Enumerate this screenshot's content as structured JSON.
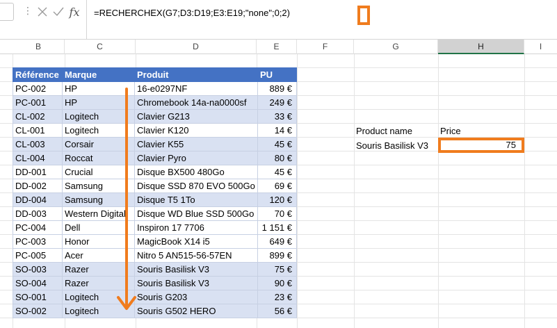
{
  "formula_bar": {
    "dots": "⋮",
    "cancel_icon": "close-icon",
    "enter_icon": "check-icon",
    "fx_label": "fx",
    "formula": "=RECHERCHEX(G7;D3:D19;E3:E19;\"none\";0;2)"
  },
  "columns": [
    "B",
    "C",
    "D",
    "E",
    "F",
    "G",
    "H",
    "I"
  ],
  "selected_column": "H",
  "table": {
    "headers": [
      "Référence",
      "Marque",
      "Produit",
      "PU"
    ],
    "rows": [
      [
        "PC-002",
        "HP",
        "16-e0297NF",
        "889 €"
      ],
      [
        "PC-001",
        "HP",
        "Chromebook 14a-na0000sf",
        "249 €"
      ],
      [
        "CL-002",
        "Logitech",
        "Clavier G213",
        "33 €"
      ],
      [
        "CL-001",
        "Logitech",
        "Clavier K120",
        "14 €"
      ],
      [
        "CL-003",
        "Corsair",
        "Clavier K55",
        "45 €"
      ],
      [
        "CL-004",
        "Roccat",
        "Clavier Pyro",
        "80 €"
      ],
      [
        "DD-001",
        "Crucial",
        "Disque BX500 480Go",
        "45 €"
      ],
      [
        "DD-002",
        "Samsung",
        "Disque SSD 870 EVO 500Go",
        "69 €"
      ],
      [
        "DD-004",
        "Samsung",
        "Disque T5 1To",
        "120 €"
      ],
      [
        "DD-003",
        "Western Digital",
        "Disque WD Blue SSD 500Go",
        "70 €"
      ],
      [
        "PC-004",
        "Dell",
        "Inspiron 17 7706",
        "1 151 €"
      ],
      [
        "PC-003",
        "Honor",
        "MagicBook X14 i5",
        "649 €"
      ],
      [
        "PC-005",
        "Acer",
        "Nitro 5 AN515-56-57EN",
        "899 €"
      ],
      [
        "SO-003",
        "Razer",
        "Souris Basilisk V3",
        "75 €"
      ],
      [
        "SO-004",
        "Razer",
        "Souris Basilisk V3",
        "90 €"
      ],
      [
        "SO-001",
        "Logitech",
        "Souris G203",
        "23 €"
      ],
      [
        "SO-002",
        "Logitech",
        "Souris G502 HERO",
        "56 €"
      ]
    ],
    "banded": [
      false,
      true,
      true,
      false,
      true,
      true,
      false,
      false,
      true,
      false,
      false,
      false,
      false,
      true,
      true,
      true,
      true
    ]
  },
  "lookup": {
    "g6_label": "Product name",
    "h6_label": "Price",
    "g7_value": "Souris Basilisk V3",
    "h7_value": "75"
  },
  "colors": {
    "accent_orange": "#f07c1e",
    "header_blue": "#4472c4",
    "band_blue": "#d9e1f2"
  }
}
